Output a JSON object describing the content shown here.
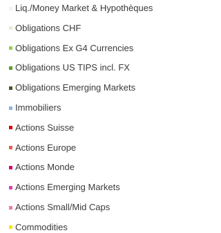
{
  "chart_data": {
    "type": "legend",
    "legend": {
      "placement": "left",
      "entries": [
        {
          "label": "Liq./Money Market & Hypothèques",
          "color": "#f2f2f2"
        },
        {
          "label": "Obligations CHF",
          "color": "#e4efcf"
        },
        {
          "label": "Obligations Ex G4 Currencies",
          "color": "#9bcf48"
        },
        {
          "label": "Obligations US TIPS incl. FX",
          "color": "#5f9b2b"
        },
        {
          "label": "Obligations Emerging Markets",
          "color": "#3f5c23"
        },
        {
          "label": "Immobiliers",
          "color": "#8db3e2"
        },
        {
          "label": "Actions Suisse",
          "color": "#e00000"
        },
        {
          "label": "Actions Europe",
          "color": "#ef5a4d"
        },
        {
          "label": "Actions Monde",
          "color": "#d5006f"
        },
        {
          "label": "Actions Emerging Markets",
          "color": "#e43ab7"
        },
        {
          "label": "Actions Small/Mid Caps",
          "color": "#f07aa2"
        },
        {
          "label": "Commodities",
          "color": "#ffe400"
        }
      ]
    }
  }
}
